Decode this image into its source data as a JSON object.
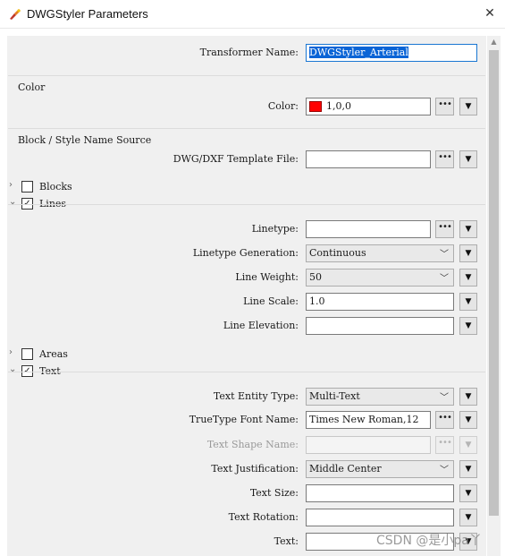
{
  "window": {
    "title": "DWGStyler Parameters",
    "close_glyph": "✕"
  },
  "transformer": {
    "label": "Transformer Name:",
    "value": "DWGStyler_Arterial"
  },
  "color_group": {
    "title": "Color",
    "color_label": "Color:",
    "color_value": "1,0,0",
    "swatch_color": "#ff0000"
  },
  "block_group": {
    "title": "Block / Style Name Source",
    "template_label": "DWG/DXF Template File:",
    "template_value": ""
  },
  "sections": {
    "blocks": {
      "label": "Blocks",
      "checked": false,
      "expanded": false
    },
    "lines": {
      "label": "Lines",
      "checked": true,
      "expanded": true
    },
    "areas": {
      "label": "Areas",
      "checked": false,
      "expanded": false
    },
    "text": {
      "label": "Text",
      "checked": true,
      "expanded": true
    }
  },
  "lines": {
    "linetype_label": "Linetype:",
    "linetype_value": "",
    "generation_label": "Linetype Generation:",
    "generation_value": "Continuous",
    "weight_label": "Line Weight:",
    "weight_value": "50",
    "scale_label": "Line Scale:",
    "scale_value": "1.0",
    "elevation_label": "Line Elevation:",
    "elevation_value": ""
  },
  "text": {
    "entity_type_label": "Text Entity Type:",
    "entity_type_value": "Multi-Text",
    "font_name_label": "TrueType Font Name:",
    "font_name_value": "Times New Roman,12",
    "shape_name_label": "Text Shape Name:",
    "shape_name_value": "",
    "justification_label": "Text Justification:",
    "justification_value": "Middle Center",
    "size_label": "Text Size:",
    "size_value": "",
    "rotation_label": "Text Rotation:",
    "rotation_value": "",
    "text_label": "Text:",
    "text_value": ""
  },
  "glyphs": {
    "dots": "•••",
    "arrow": "▼",
    "chevron": "﹀",
    "collapsed": "›",
    "expanded": "⌄",
    "check": "✓",
    "scroll_up": "▲"
  },
  "watermark": "CSDN @是小pa丫"
}
